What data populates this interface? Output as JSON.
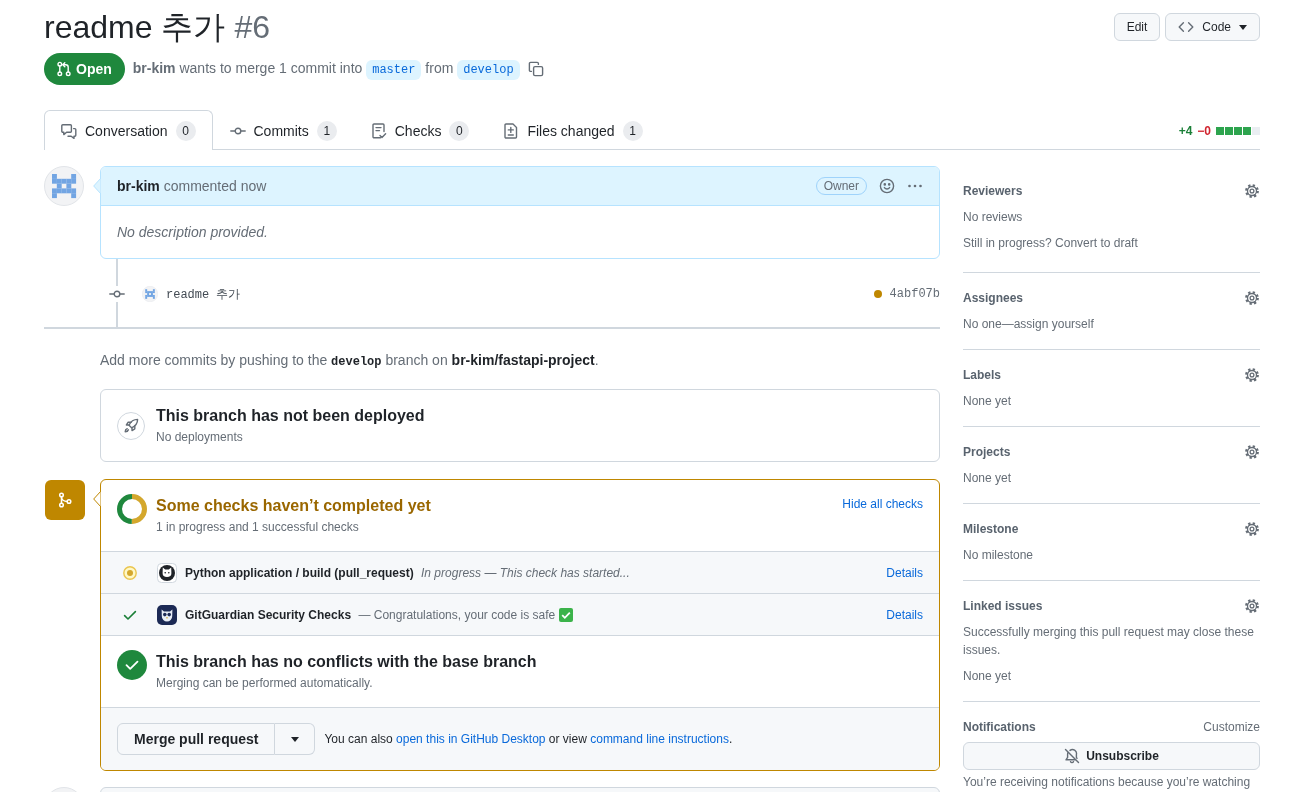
{
  "header": {
    "title": "readme 추가",
    "number": "#6",
    "buttons": [
      {
        "label": "Edit",
        "kind": "edit"
      },
      {
        "label": "Code",
        "kind": "code"
      }
    ]
  },
  "state_badge": {
    "label": "Open",
    "kind": "open"
  },
  "summary": {
    "author": "br-kim",
    "text_1": "wants to merge 1 commit into",
    "base_branch": "master",
    "text_2": "from",
    "head_branch": "develop"
  },
  "tabs": [
    {
      "label": "Conversation",
      "count": "0",
      "kind": "conversation",
      "selected": true
    },
    {
      "label": "Commits",
      "count": "1",
      "kind": "commits",
      "selected": false
    },
    {
      "label": "Checks",
      "count": "0",
      "kind": "checks",
      "selected": false
    },
    {
      "label": "Files changed",
      "count": "1",
      "kind": "files",
      "selected": false
    }
  ],
  "diffstat": {
    "additions": "+4",
    "deletions": "−0",
    "blocks": [
      {
        "kind": "added"
      },
      {
        "kind": "added"
      },
      {
        "kind": "added"
      },
      {
        "kind": "added"
      },
      {
        "kind": "neutral"
      }
    ]
  },
  "timeline": {
    "comment": {
      "author": "br-kim",
      "action": "commented now",
      "role": "Owner",
      "body": "No description provided."
    },
    "commits": [
      {
        "message": "readme 추가",
        "color": "#bf8700",
        "sha": "4abf07b"
      }
    ],
    "push_hint": [
      {
        "kind": "text",
        "text": "Add more commits by pushing to the "
      },
      {
        "kind": "code",
        "text": "develop"
      },
      {
        "kind": "text",
        "text": " branch on "
      },
      {
        "kind": "strong",
        "text": "br-kim/fastapi-project"
      },
      {
        "kind": "text",
        "text": "."
      }
    ],
    "deployment": {
      "title": "This branch has not been deployed",
      "subtitle": "No deployments"
    },
    "merge": {
      "kind": "pending",
      "title": "Some checks haven’t completed yet",
      "subtitle": "1 in progress and 1 successful checks",
      "toggle": "Hide all checks",
      "checks": [
        {
          "kind": "github",
          "completed": false,
          "name": "Python application / build (pull_request)",
          "description": "In progress — This check has started...",
          "check_emoji": false,
          "link": "Details"
        },
        {
          "kind": "gitguardian",
          "completed": true,
          "name": "GitGuardian Security Checks",
          "description": "— Congratulations, your code is safe",
          "check_emoji": true,
          "link": "Details"
        }
      ],
      "conflicts": {
        "ok": true,
        "title": "This branch has no conflicts with the base branch",
        "subtitle": "Merging can be performed automatically."
      },
      "button": "Merge pull request",
      "hint": [
        {
          "kind": "text",
          "text": "You can also "
        },
        {
          "kind": "link",
          "text": "open this in GitHub Desktop"
        },
        {
          "kind": "text",
          "text": " or view "
        },
        {
          "kind": "link",
          "text": "command line instructions"
        },
        {
          "kind": "text",
          "text": "."
        }
      ]
    }
  },
  "sidebar": {
    "sections": [
      {
        "title": "Reviewers",
        "lines": [
          "No reviews",
          "Still in progress? Convert to draft"
        ]
      },
      {
        "title": "Assignees",
        "lines": [
          "No one—assign yourself"
        ]
      },
      {
        "title": "Labels",
        "lines": [
          "None yet"
        ]
      },
      {
        "title": "Projects",
        "lines": [
          "None yet"
        ]
      },
      {
        "title": "Milestone",
        "lines": [
          "No milestone"
        ]
      },
      {
        "title": "Linked issues",
        "lines": [
          "Successfully merging this pull request may close these issues.",
          "None yet"
        ]
      }
    ],
    "notifications": {
      "title": "Notifications",
      "action": "Customize",
      "button": "Unsubscribe",
      "note": "You’re receiving notifications because you’re watching"
    }
  }
}
